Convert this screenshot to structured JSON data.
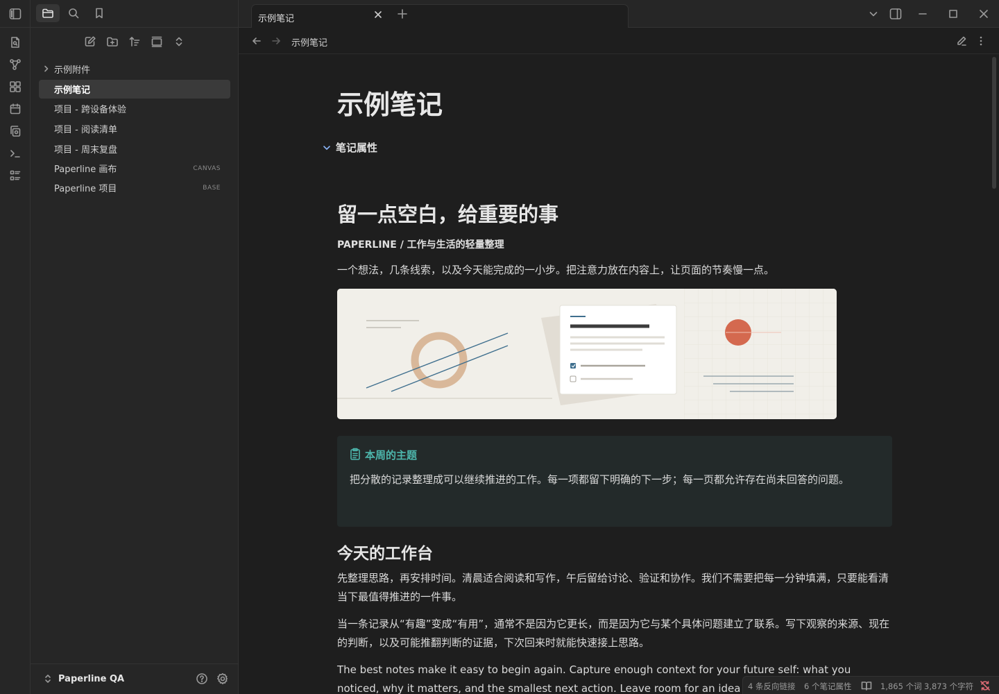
{
  "sidebar": {
    "files": [
      {
        "label": "示例附件",
        "badge": ""
      },
      {
        "label": "示例笔记",
        "badge": ""
      },
      {
        "label": "项目 - 跨设备体验",
        "badge": ""
      },
      {
        "label": "项目 - 阅读清单",
        "badge": ""
      },
      {
        "label": "项目 - 周末复盘",
        "badge": ""
      },
      {
        "label": "Paperline 画布",
        "badge": "CANVAS"
      },
      {
        "label": "Paperline 项目",
        "badge": "BASE"
      }
    ],
    "vault_name": "Paperline QA"
  },
  "tabs": {
    "active_title": "示例笔记"
  },
  "view_header": {
    "title": "示例笔记"
  },
  "note": {
    "title": "示例笔记",
    "properties_label": "笔记属性",
    "h1": "留一点空白，给重要的事",
    "subhead": "PAPERLINE / 工作与生活的轻量整理",
    "intro": "一个想法，几条线索，以及今天能完成的一小步。把注意力放在内容上，让页面的节奏慢一点。",
    "callout": {
      "title": "本周的主题",
      "body": "把分散的记录整理成可以继续推进的工作。每一项都留下明确的下一步；每一页都允许存在尚未回答的问题。"
    },
    "h2": "今天的工作台",
    "para1": "先整理思路，再安排时间。清晨适合阅读和写作，午后留给讨论、验证和协作。我们不需要把每一分钟填满，只要能看清当下最值得推进的一件事。",
    "para2": "当一条记录从“有趣”变成“有用”，通常不是因为它更长，而是因为它与某个具体问题建立了联系。写下观察的来源、现在的判断，以及可能推翻判断的证据，下次回来时就能快速接上思路。",
    "para3": "The best notes make it easy to begin again. Capture enough context for your future self: what you noticed, why it matters, and the smallest next action. Leave room for an idea to change as you lear"
  },
  "status": {
    "backlinks": "4 条反向链接",
    "properties": "6 个笔记属性",
    "words": "1,865 个词",
    "chars": "3,873 个字符"
  },
  "colors": {
    "accent_teal": "#4db6ac",
    "hero_circle": "#d4694f"
  }
}
